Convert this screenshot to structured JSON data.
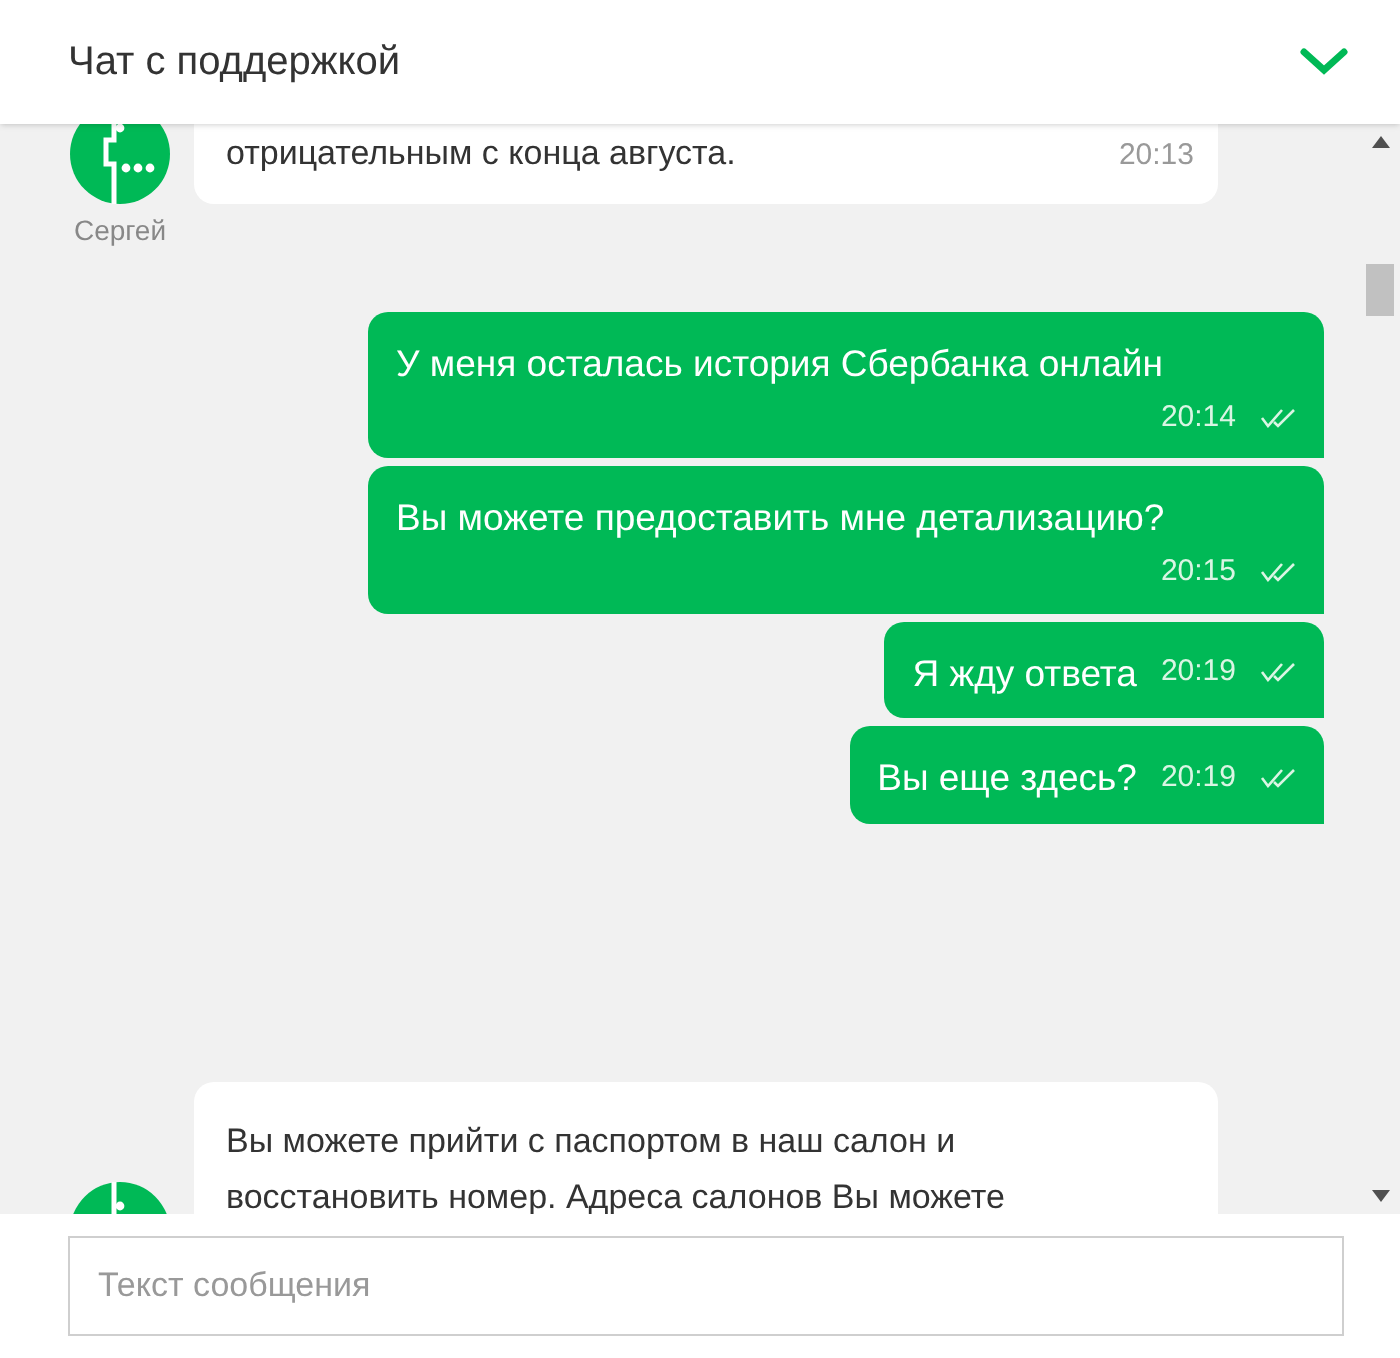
{
  "header": {
    "title": "Чат с поддержкой",
    "collapse_icon": true
  },
  "messages": [
    {
      "kind": "incoming",
      "sender": "Сергей",
      "text": "отрицательным с конца августа.",
      "time": "20:13"
    },
    {
      "kind": "outgoing",
      "text": "У меня осталась история Сбербанка онлайн",
      "time": "20:14",
      "read": true
    },
    {
      "kind": "outgoing",
      "text": "Вы можете предоставить мне детализацию?",
      "time": "20:15",
      "read": true
    },
    {
      "kind": "outgoing",
      "text": "Я жду ответа",
      "time": "20:19",
      "read": true
    },
    {
      "kind": "outgoing",
      "text": "Вы еще здесь?",
      "time": "20:19",
      "read": true
    },
    {
      "kind": "incoming_partial",
      "text": "Вы можете прийти с паспортом в наш салон и восстановить номер. Адреса салонов Вы можете"
    }
  ],
  "composer": {
    "placeholder": "Текст сообщения"
  }
}
